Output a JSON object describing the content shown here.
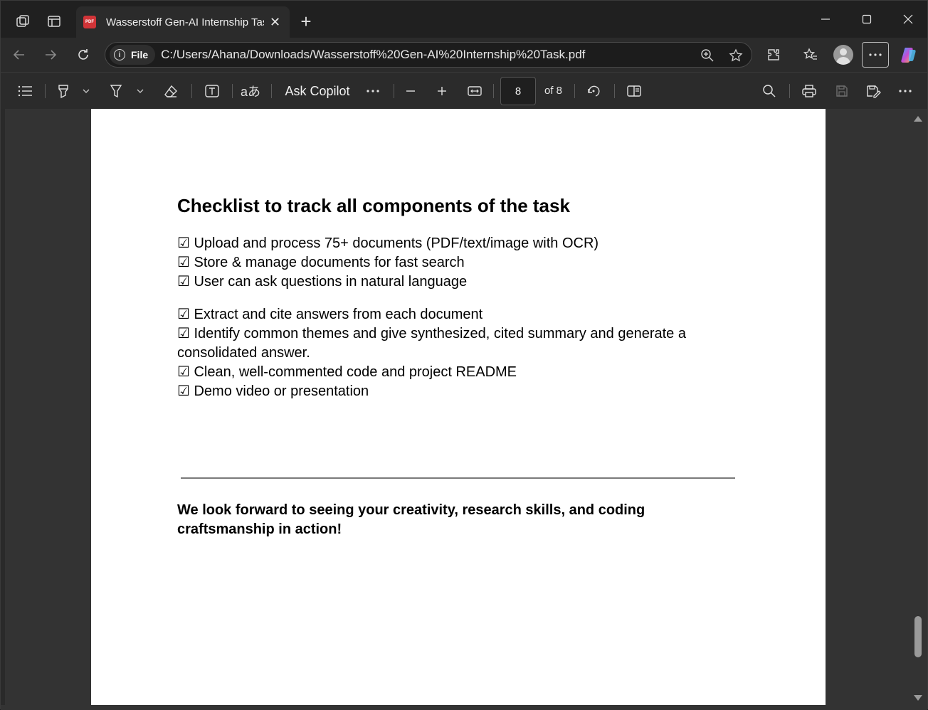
{
  "tab": {
    "title": "Wasserstoff Gen-AI Internship Tas",
    "favicon_label": "PDF"
  },
  "addressbar": {
    "scheme_label": "File",
    "url": "C:/Users/Ahana/Downloads/Wasserstoff%20Gen-AI%20Internship%20Task.pdf"
  },
  "pdf_toolbar": {
    "ask_copilot": "Ask Copilot",
    "current_page": "8",
    "of_pages": "of 8"
  },
  "document": {
    "heading": "Checklist to track all components of the task",
    "checklist_group1": [
      "☑ Upload and process 75+ documents (PDF/text/image with OCR)",
      "☑ Store & manage documents for fast search",
      "☑ User can ask questions in natural language"
    ],
    "checklist_group2": [
      "☑ Extract and cite answers from each document",
      "☑ Identify common themes and give synthesized, cited summary and generate a consolidated answer.",
      "☑ Clean, well-commented code and project README",
      "☑ Demo video or presentation"
    ],
    "closing": "We look forward to seeing your creativity, research skills, and coding craftsmanship in action!"
  },
  "colors": {
    "chrome_bg": "#202020",
    "toolbar_bg": "#2b2b2b",
    "page_bg": "#ffffff",
    "viewer_bg": "#333333"
  }
}
